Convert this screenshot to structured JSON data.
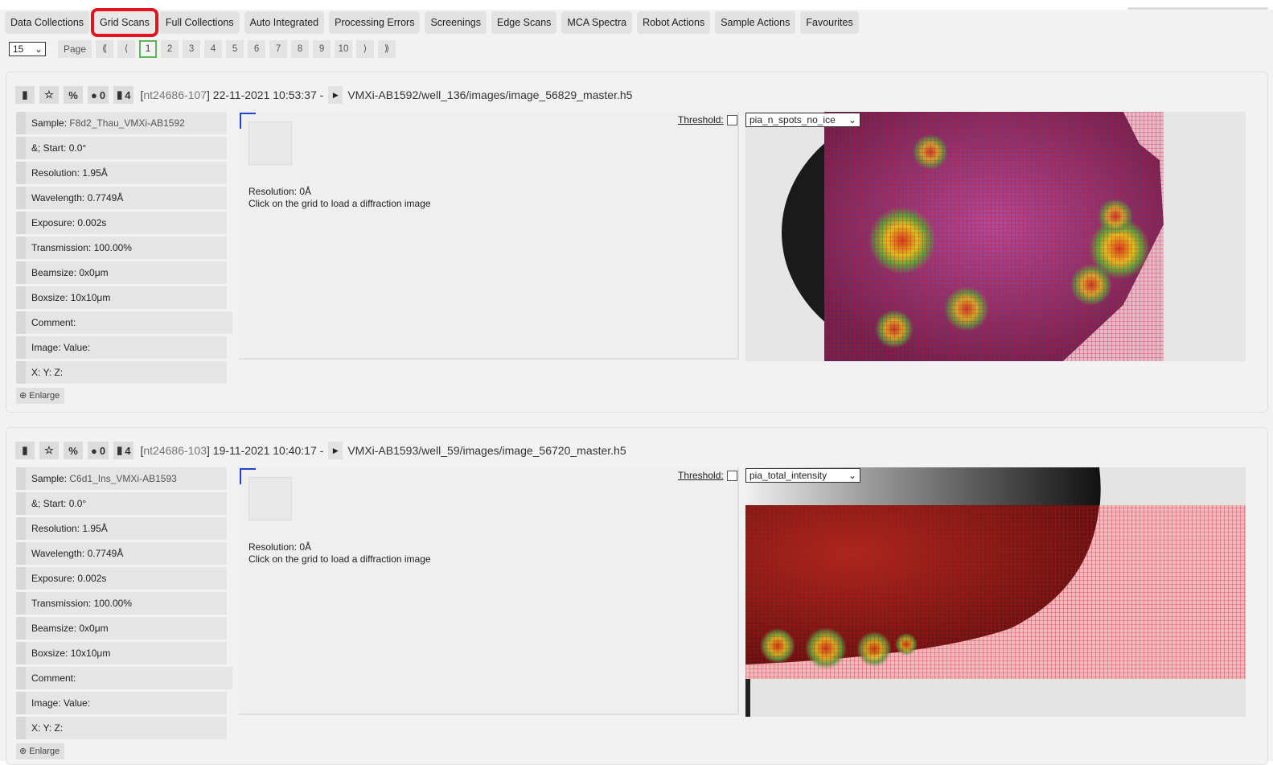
{
  "tabs": [
    {
      "label": "Data Collections",
      "active": false
    },
    {
      "label": "Grid Scans",
      "active": true
    },
    {
      "label": "Full Collections",
      "active": false
    },
    {
      "label": "Auto Integrated",
      "active": false
    },
    {
      "label": "Processing Errors",
      "active": false
    },
    {
      "label": "Screenings",
      "active": false
    },
    {
      "label": "Edge Scans",
      "active": false
    },
    {
      "label": "MCA Spectra",
      "active": false
    },
    {
      "label": "Robot Actions",
      "active": false
    },
    {
      "label": "Sample Actions",
      "active": false
    },
    {
      "label": "Favourites",
      "active": false
    }
  ],
  "pager": {
    "per_page": "15",
    "page_label": "Page",
    "first": "⟪",
    "prev": "⟨",
    "pages": [
      "1",
      "2",
      "3",
      "4",
      "5",
      "6",
      "7",
      "8",
      "9",
      "10"
    ],
    "current": "1",
    "next": "⟩",
    "last": "⟫"
  },
  "collections": [
    {
      "comments": "0",
      "attachments": "4",
      "visit": "nt24686-107",
      "datetime": "22-11-2021 10:53:37 -",
      "path": "VMXi-AB1592/well_136/images/image_56829_master.h5",
      "params": [
        {
          "label": "Sample:",
          "value": "F8d2_Thau_VMXi-AB1592"
        },
        {
          "label": "&; Start:",
          "value": "0.0°"
        },
        {
          "label": "Resolution:",
          "value": "1.95Å"
        },
        {
          "label": "Wavelength:",
          "value": "0.7749Å"
        },
        {
          "label": "Exposure:",
          "value": "0.002s"
        },
        {
          "label": "Transmission:",
          "value": "100.00%"
        },
        {
          "label": "Beamsize:",
          "value": "0x0μm"
        },
        {
          "label": "Boxsize:",
          "value": "10x10μm"
        },
        {
          "label": "Comment:",
          "value": ""
        },
        {
          "label": "Image:",
          "value": "Value:"
        },
        {
          "label": "X:",
          "value": "Y: Z:"
        }
      ],
      "enlarge": "Enlarge",
      "diff_resolution": "Resolution: 0Å",
      "diff_hint": "Click on the grid to load a diffraction image",
      "threshold_label": "Threshold:",
      "metric": "pia_n_spots_no_ice"
    },
    {
      "comments": "0",
      "attachments": "4",
      "visit": "nt24686-103",
      "datetime": "19-11-2021 10:40:17 -",
      "path": "VMXi-AB1593/well_59/images/image_56720_master.h5",
      "params": [
        {
          "label": "Sample:",
          "value": "C6d1_Ins_VMXi-AB1593"
        },
        {
          "label": "&; Start:",
          "value": "0.0°"
        },
        {
          "label": "Resolution:",
          "value": "1.95Å"
        },
        {
          "label": "Wavelength:",
          "value": "0.7749Å"
        },
        {
          "label": "Exposure:",
          "value": "0.002s"
        },
        {
          "label": "Transmission:",
          "value": "100.00%"
        },
        {
          "label": "Beamsize:",
          "value": "0x0μm"
        },
        {
          "label": "Boxsize:",
          "value": "10x10μm"
        },
        {
          "label": "Comment:",
          "value": ""
        },
        {
          "label": "Image:",
          "value": "Value:"
        },
        {
          "label": "X:",
          "value": "Y: Z:"
        }
      ],
      "enlarge": "Enlarge",
      "diff_resolution": "Resolution: 0Å",
      "diff_hint": "Click on the grid to load a diffraction image",
      "threshold_label": "Threshold:",
      "metric": "pia_total_intensity"
    }
  ]
}
